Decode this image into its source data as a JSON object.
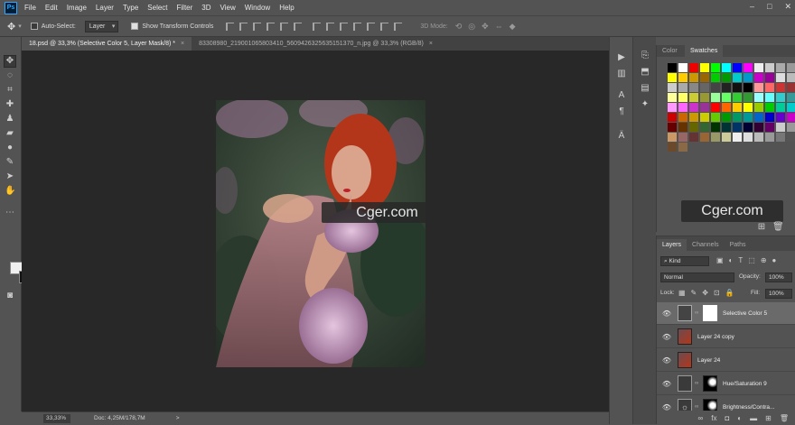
{
  "app": {
    "logo": "Ps"
  },
  "menu": [
    "File",
    "Edit",
    "Image",
    "Layer",
    "Type",
    "Select",
    "Filter",
    "3D",
    "View",
    "Window",
    "Help"
  ],
  "window_controls": [
    "–",
    "□",
    "✕"
  ],
  "options": {
    "auto_select_label": "Auto-Select:",
    "auto_select_checked": false,
    "target_value": "Layer",
    "show_transform_label": "Show Transform Controls",
    "show_transform_checked": true,
    "mode_label": "3D Mode:"
  },
  "tabs": [
    {
      "label": "18.psd @ 33,3% (Selective Color 5, Layer Mask/8) *",
      "close": "×",
      "active": true
    },
    {
      "label": "83308980_2190010658034​10_5609426325635151370_n.jpg @ 33,3% (RGB/8)",
      "close": "×",
      "active": false
    }
  ],
  "status": {
    "zoom": "33,33%",
    "doc": "Doc: 4,25M/178,7M",
    "arrow": ">"
  },
  "watermark": "Cger.com",
  "panel_tabs": {
    "color": "Color",
    "swatches": "Swatches"
  },
  "layers_tabs": [
    "Layers",
    "Channels",
    "Paths"
  ],
  "layers": {
    "filter_label": "Kind",
    "blend_mode": "Normal",
    "opacity_label": "Opacity:",
    "opacity_value": "100%",
    "lock_label": "Lock:",
    "fill_label": "Fill:",
    "fill_value": "100%",
    "items": [
      {
        "name": "Selective Color 5",
        "selected": true
      },
      {
        "name": "Layer 24 copy",
        "selected": false
      },
      {
        "name": "Layer 24",
        "selected": false
      },
      {
        "name": "Hue/Saturation 9",
        "selected": false
      },
      {
        "name": "Brightness/Contra...",
        "selected": false
      }
    ],
    "footer_icons": [
      "link-icon",
      "fx-icon",
      "mask-icon",
      "adjustment-icon",
      "folder-icon",
      "new-layer-icon",
      "trash-icon"
    ]
  },
  "colors": {
    "foreground": "#f0f0f0",
    "background": "#111111",
    "accent": "#31a8ff"
  }
}
